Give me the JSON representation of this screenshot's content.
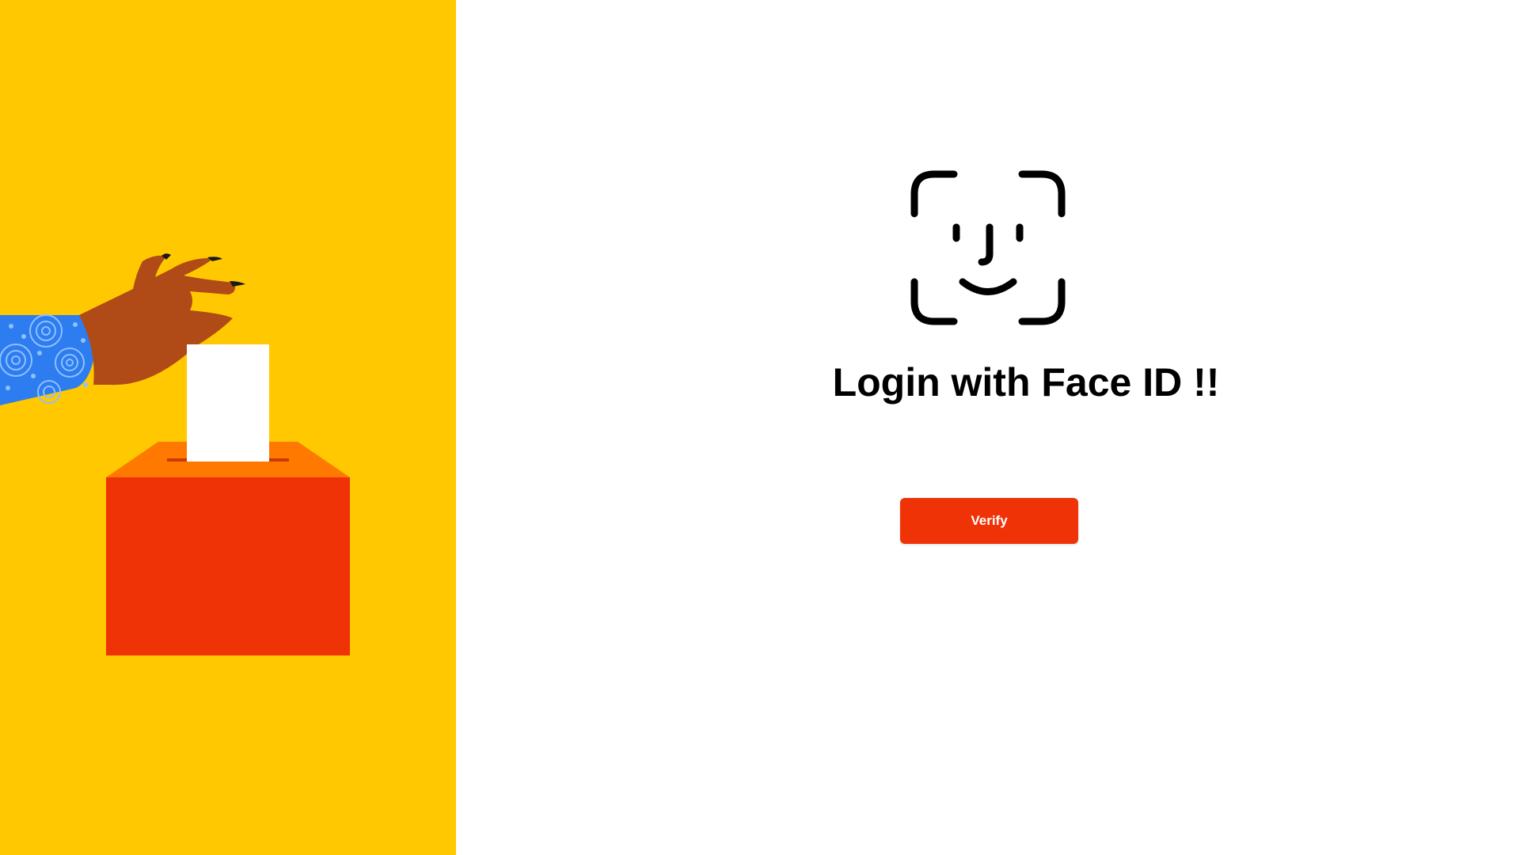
{
  "login": {
    "title": "Login with Face ID !!",
    "verify_label": "Verify"
  },
  "icons": {
    "face_id": "face-id-icon",
    "illustration": "ballot-box-illustration"
  },
  "colors": {
    "left_panel_bg": "#ffc800",
    "button_bg": "#f03207",
    "button_text": "#ffffff",
    "ballot_box_front": "#f03207",
    "ballot_box_top": "#ff7800",
    "sleeve": "#2d7cf0",
    "skin": "#b04a17"
  }
}
